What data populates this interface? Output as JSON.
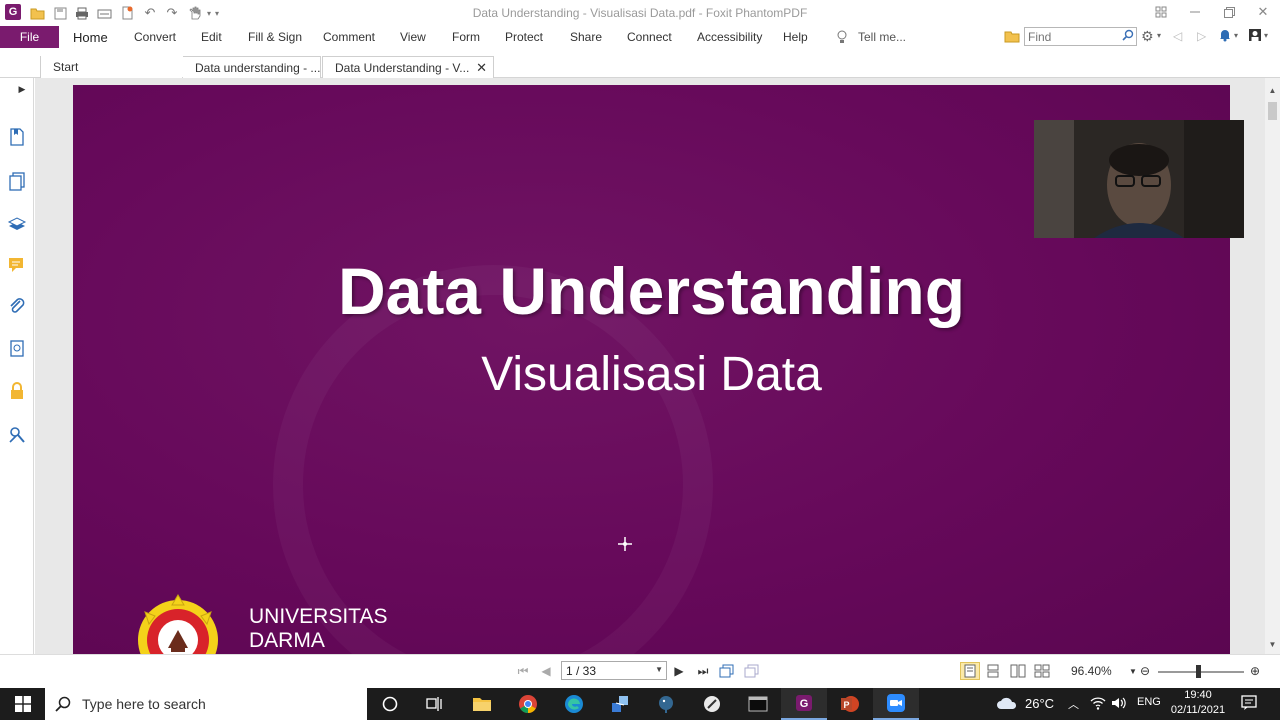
{
  "window": {
    "title": "Data Understanding - Visualisasi Data.pdf - Foxit PhantomPDF"
  },
  "ribbon": {
    "file": "File",
    "tabs": [
      "Home",
      "Convert",
      "Edit",
      "Fill & Sign",
      "Comment",
      "View",
      "Form",
      "Protect",
      "Share",
      "Connect",
      "Accessibility",
      "Help"
    ],
    "tell_me": "Tell me...",
    "find_placeholder": "Find"
  },
  "doc_tabs": {
    "start": "Start",
    "tab1": "Data understanding - ...",
    "tab2": "Data Understanding - V..."
  },
  "slide": {
    "title": "Data Understanding",
    "subtitle": "Visualisasi Data",
    "uni_line1": "UNIVERSITAS",
    "uni_line2": "DARMA"
  },
  "status": {
    "page": "1 / 33",
    "zoom": "96.40%"
  },
  "taskbar": {
    "search_placeholder": "Type here to search",
    "weather": "26°C",
    "lang": "ENG",
    "time": "19:40",
    "date": "02/11/2021"
  },
  "colors": {
    "brand": "#7a1b6e",
    "slide_bg": "#6a0d5a",
    "taskbar": "#1c1c1c"
  }
}
